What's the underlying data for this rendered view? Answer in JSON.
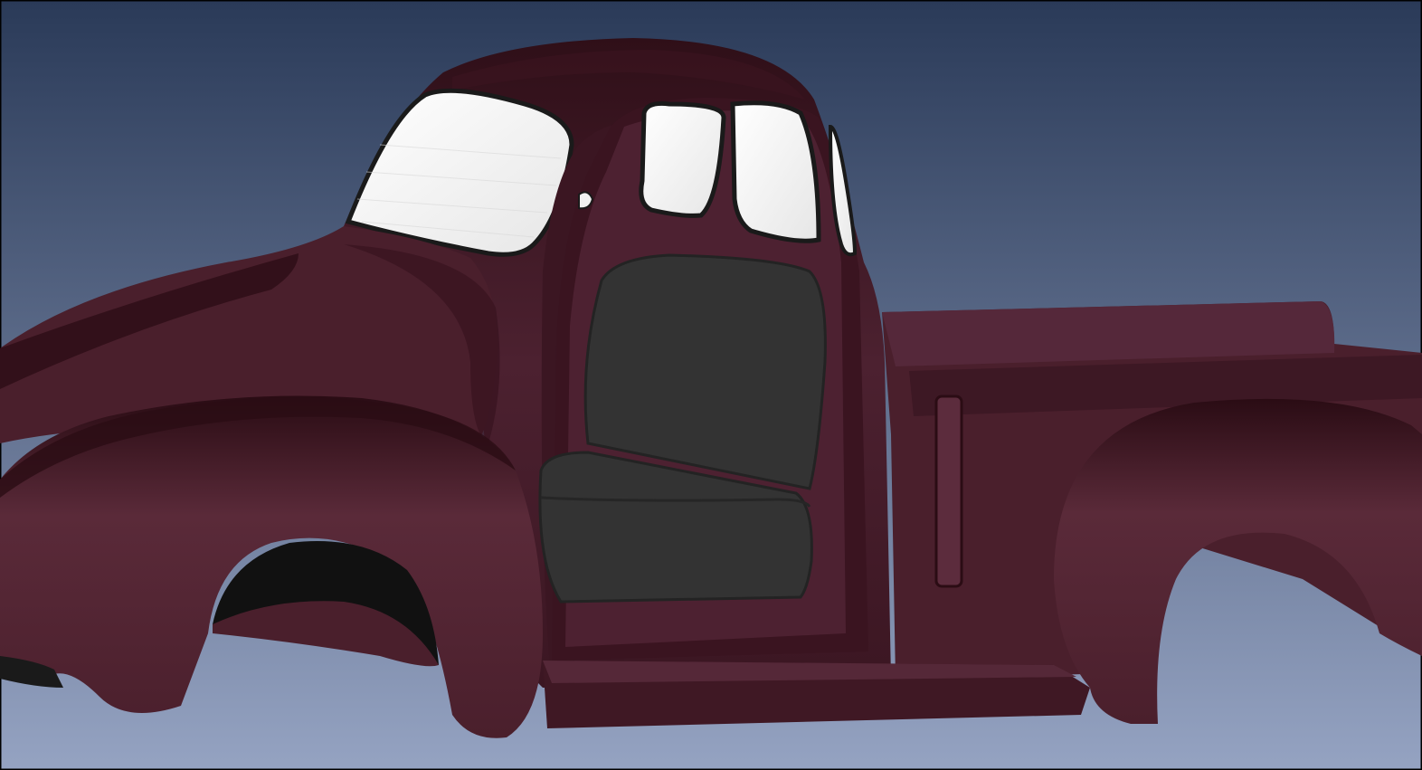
{
  "viewport": {
    "background_top": "#2a3a58",
    "background_bottom": "#95a3c2"
  },
  "model": {
    "body_color": "#4a1f2c",
    "body_shadow": "#2b0c14",
    "body_highlight": "#5a2a39",
    "glass_color": "#f2f2f2",
    "glass_frame": "#1a1a1a",
    "seat_color": "#333333",
    "seat_shadow": "#222222"
  }
}
